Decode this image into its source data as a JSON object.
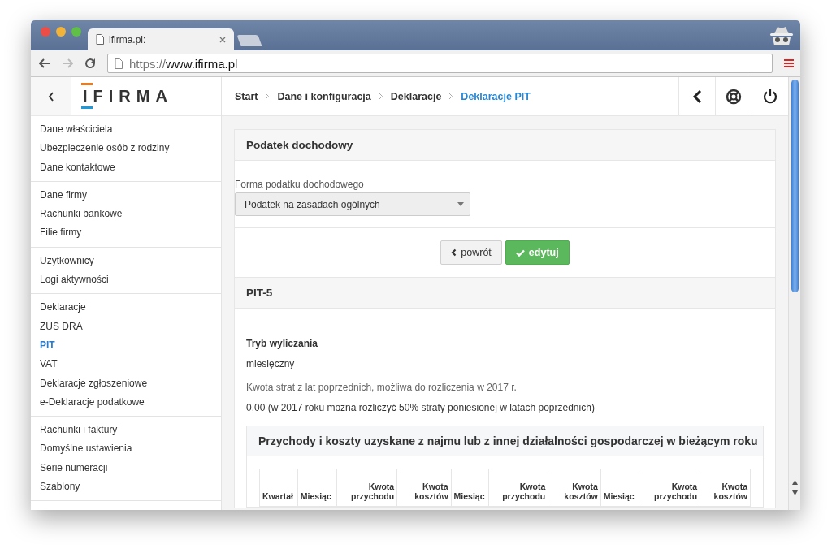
{
  "browser": {
    "tabs": [
      {
        "title": "ifirma.pl:",
        "selected": true
      }
    ],
    "url": {
      "scheme": "https://",
      "host": "www.ifirma.pl"
    }
  },
  "logo": "IFIRMA",
  "sidebar": {
    "groups": [
      {
        "items": [
          {
            "label": "Dane właściciela",
            "selected": false
          },
          {
            "label": "Ubezpieczenie osób z rodziny",
            "selected": false
          },
          {
            "label": "Dane kontaktowe",
            "selected": false
          }
        ]
      },
      {
        "items": [
          {
            "label": "Dane firmy",
            "selected": false
          },
          {
            "label": "Rachunki bankowe",
            "selected": false
          },
          {
            "label": "Filie firmy",
            "selected": false
          }
        ]
      },
      {
        "items": [
          {
            "label": "Użytkownicy",
            "selected": false
          },
          {
            "label": "Logi aktywności",
            "selected": false
          }
        ]
      },
      {
        "items": [
          {
            "label": "Deklaracje",
            "selected": false
          },
          {
            "label": "ZUS DRA",
            "selected": false
          },
          {
            "label": "PIT",
            "selected": true
          },
          {
            "label": "VAT",
            "selected": false
          },
          {
            "label": "Deklaracje zgłoszeniowe",
            "selected": false
          },
          {
            "label": "e-Deklaracje podatkowe",
            "selected": false
          }
        ]
      },
      {
        "items": [
          {
            "label": "Rachunki i faktury",
            "selected": false
          },
          {
            "label": "Domyślne ustawienia",
            "selected": false
          },
          {
            "label": "Serie numeracji",
            "selected": false
          },
          {
            "label": "Szablony",
            "selected": false
          }
        ]
      }
    ]
  },
  "breadcrumbs": [
    {
      "label": "Start",
      "current": false
    },
    {
      "label": "Dane i konfiguracja",
      "current": false
    },
    {
      "label": "Deklaracje",
      "current": false
    },
    {
      "label": "Deklaracje PIT",
      "current": true
    }
  ],
  "tax_panel": {
    "title": "Podatek dochodowy",
    "field_label": "Forma podatku dochodowego",
    "select_value": "Podatek na zasadach ogólnych",
    "buttons": [
      {
        "label": "powrót",
        "kind": "back"
      },
      {
        "label": "edytuj",
        "kind": "edit"
      }
    ]
  },
  "pit_panel": {
    "title": "PIT-5",
    "fields": [
      {
        "label": "Tryb wyliczania",
        "kind": "strong",
        "value": "miesięczny"
      },
      {
        "label": "Kwota strat z lat poprzednich, możliwa do rozliczenia w 2017 r.",
        "kind": "muted",
        "value": "0,00 (w 2017 roku można rozliczyć 50% straty poniesionej w latach poprzednich)"
      }
    ],
    "table_title": "Przychody i koszty uzyskane z najmu lub z innej działalności gospodarczej w bieżącym roku",
    "columns": [
      "Kwartał",
      "Miesiąc",
      "Kwota przychodu",
      "Kwota kosztów",
      "Miesiąc",
      "Kwota przychodu",
      "Kwota kosztów",
      "Miesiąc",
      "Kwota przychodu",
      "Kwota kosztów"
    ]
  }
}
